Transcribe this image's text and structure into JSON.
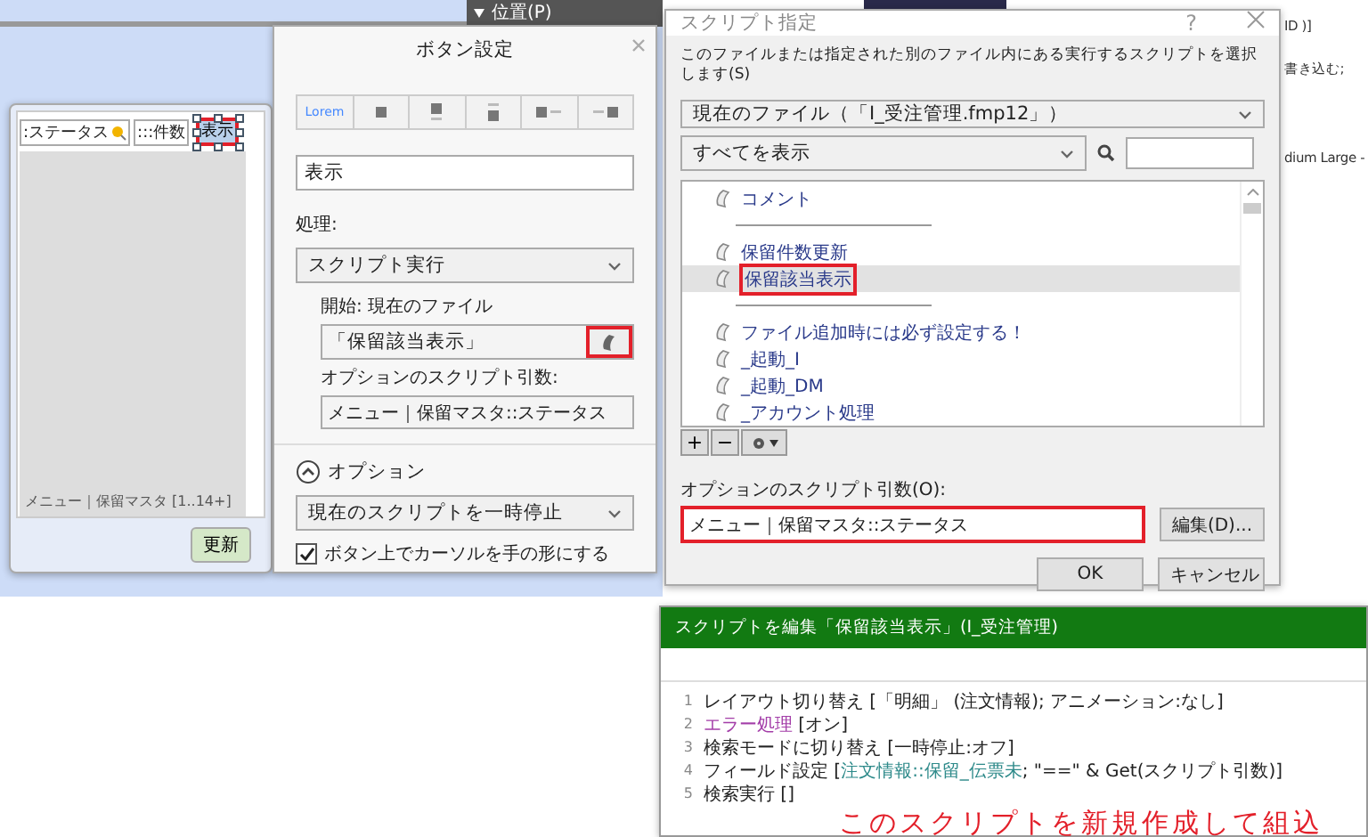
{
  "background": {
    "section_header": "位置(P)",
    "fragments": [
      "ID )]",
      "書き込む;",
      "dium Large -"
    ]
  },
  "layout_panel": {
    "fields": [
      {
        "label": ":ステータス",
        "kind": "search"
      },
      {
        "label": ":::件数",
        "kind": "plain"
      }
    ],
    "button": {
      "label": "表示",
      "selected": true,
      "highlighted": true
    },
    "portal_footer": "メニュー｜保留マスタ [1..14+]",
    "update_button": "更新"
  },
  "button_settings": {
    "title": "ボタン設定",
    "style_options": [
      {
        "kind": "text",
        "label": "Lorem"
      },
      {
        "kind": "icon"
      },
      {
        "kind": "icon-top"
      },
      {
        "kind": "icon-bottom"
      },
      {
        "kind": "icon-left"
      },
      {
        "kind": "icon-right"
      }
    ],
    "label_value": "表示",
    "action_label": "処理:",
    "action": "スクリプト実行",
    "start_label": "開始:  現在のファイル",
    "script": "「保留該当表示」",
    "script_button_highlighted": true,
    "param_label": "オプションのスクリプト引数:",
    "param": "メニュー｜保留マスタ::ステータス",
    "options_label": "オプション",
    "options_expanded": true,
    "pause_option": "現在のスクリプトを一時停止",
    "hand_cursor": {
      "label": "ボタン上でカーソルを手の形にする",
      "checked": true
    }
  },
  "script_dialog": {
    "title": "スクリプト指定",
    "help": "?",
    "description": "このファイルまたは指定された別のファイル内にある実行するスクリプトを選択します(S)",
    "file_dropdown": "現在のファイル（「I_受注管理.fmp12」）",
    "filter_dropdown": "すべてを表示",
    "scripts": [
      {
        "kind": "script",
        "label": "コメント",
        "selected": false,
        "highlighted": false
      },
      {
        "kind": "separator"
      },
      {
        "kind": "script",
        "label": "保留件数更新",
        "selected": false,
        "highlighted": false
      },
      {
        "kind": "script",
        "label": "保留該当表示",
        "selected": true,
        "highlighted": true
      },
      {
        "kind": "separator"
      },
      {
        "kind": "script",
        "label": "ファイル追加時には必ず設定する！",
        "selected": false,
        "highlighted": false
      },
      {
        "kind": "script",
        "label": "_起動_I",
        "selected": false,
        "highlighted": false
      },
      {
        "kind": "script",
        "label": "_起動_DM",
        "selected": false,
        "highlighted": false
      },
      {
        "kind": "script",
        "label": "_アカウント処理",
        "selected": false,
        "highlighted": false
      }
    ],
    "tool_buttons": [
      "+",
      "−"
    ],
    "param_label": "オプションのスクリプト引数(O):",
    "param": "メニュー｜保留マスタ::ステータス",
    "param_highlighted": true,
    "edit_button": "編集(D)...",
    "ok_button": "OK",
    "cancel_button": "キャンセル"
  },
  "script_editor": {
    "title": "スクリプトを編集「保留該当表示」(I_受注管理)",
    "lines": [
      {
        "number": "1",
        "parts": [
          {
            "kind": "step",
            "text": "レイアウト切り替え [「明細」 (注文情報); アニメーション:なし]"
          }
        ]
      },
      {
        "number": "2",
        "parts": [
          {
            "kind": "control",
            "text": "エラー処理"
          },
          {
            "kind": "step",
            "text": " [オン]"
          }
        ]
      },
      {
        "number": "3",
        "parts": [
          {
            "kind": "step",
            "text": "検索モードに切り替え [一時停止:オフ]"
          }
        ]
      },
      {
        "number": "4",
        "parts": [
          {
            "kind": "step",
            "text": "フィールド設定 ["
          },
          {
            "kind": "field",
            "text": "注文情報::保留_伝票未"
          },
          {
            "kind": "step",
            "text": "; \"==\" & Get(スクリプト引数)]"
          }
        ]
      },
      {
        "number": "5",
        "parts": [
          {
            "kind": "step",
            "text": "検索実行 []"
          }
        ]
      }
    ],
    "annotation": "このスクリプトを新規作成して組込"
  }
}
